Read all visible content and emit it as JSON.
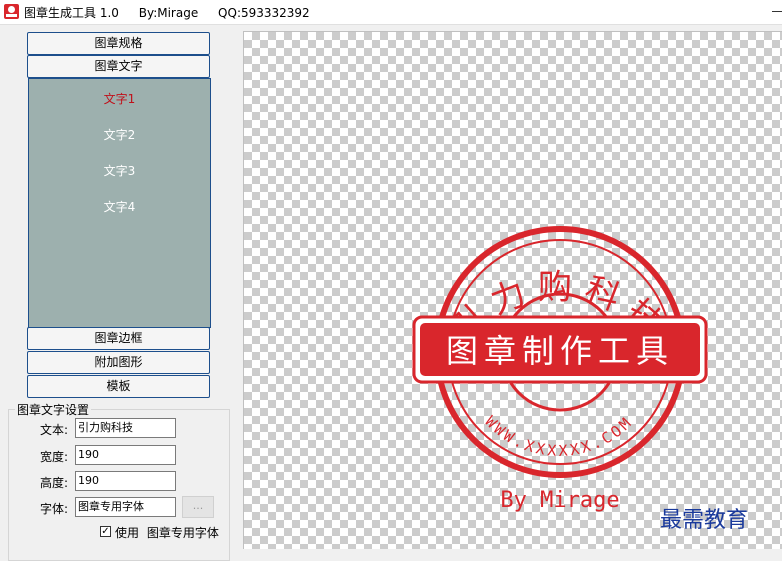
{
  "window": {
    "title": "图章生成工具 1.0",
    "author": "By:Mirage",
    "qq": "QQ:593332392"
  },
  "nav": {
    "spec": "图章规格",
    "text": "图章文字",
    "border": "图章边框",
    "shape": "附加图形",
    "template": "模板"
  },
  "text_list": [
    "文字1",
    "文字2",
    "文字3",
    "文字4"
  ],
  "settings": {
    "group_title": "图章文字设置",
    "text_label": "文本:",
    "text_value": "引力购科技",
    "width_label": "宽度:",
    "width_value": "190",
    "height_label": "高度:",
    "height_value": "190",
    "font_label": "字体:",
    "font_value": "图章专用字体",
    "browse": "...",
    "use_label": "使用",
    "use_font": "图章专用字体",
    "use_checked": true
  },
  "stamp": {
    "arc_text": "引力购科技",
    "banner": "图章制作工具",
    "bottom_arc": "WWW.XXXXXX.COM",
    "signature": "By Mirage",
    "color": "#d9262c"
  },
  "watermark": "最需教育"
}
